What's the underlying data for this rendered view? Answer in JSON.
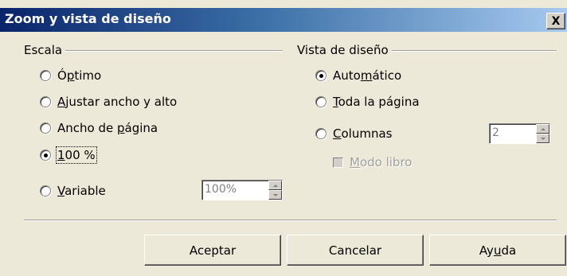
{
  "window": {
    "title": "Zoom y vista de diseño",
    "close_label": "X"
  },
  "zoom": {
    "label": "Escala",
    "options": [
      {
        "pre": "Ó",
        "key": "p",
        "post": "timo",
        "selected": false
      },
      {
        "pre": "",
        "key": "A",
        "post": "justar ancho y alto",
        "selected": false
      },
      {
        "pre": "Ancho de ",
        "key": "p",
        "post": "ágina",
        "selected": false
      },
      {
        "pre": "",
        "key": "1",
        "post": "00 %",
        "selected": true
      },
      {
        "pre": "",
        "key": "V",
        "post": "ariable",
        "selected": false
      }
    ],
    "variable_value": "100%"
  },
  "layout": {
    "label": "Vista de diseño",
    "options": [
      {
        "pre": "Auto",
        "key": "m",
        "post": "ático",
        "selected": true
      },
      {
        "pre": "",
        "key": "T",
        "post": "oda la página",
        "selected": false
      },
      {
        "pre": "",
        "key": "C",
        "post": "olumnas",
        "selected": false
      }
    ],
    "columns_value": "2",
    "book_mode": {
      "pre": "",
      "key": "M",
      "post": "odo libro",
      "checked": false,
      "enabled": false
    }
  },
  "buttons": {
    "ok": "Aceptar",
    "cancel": "Cancelar",
    "help_pre": "Ay",
    "help_key": "u",
    "help_post": "da"
  }
}
